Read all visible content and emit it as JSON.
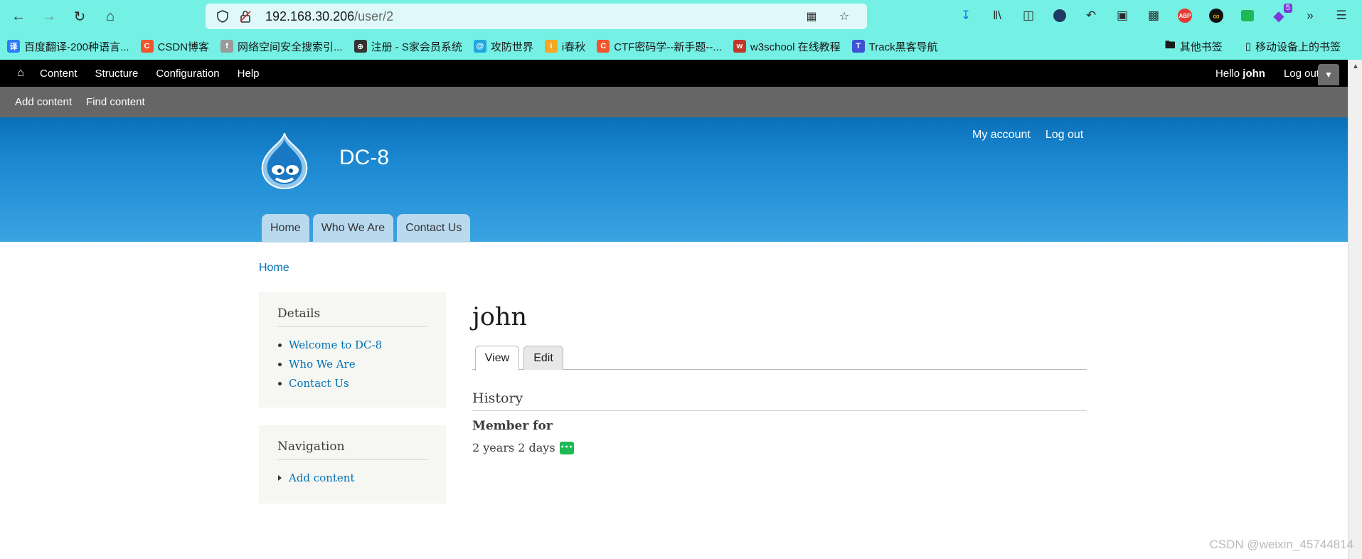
{
  "browser": {
    "url_host": "192.168.30.206",
    "url_path": "/user/2",
    "extension_badge": "5",
    "bookmarks": [
      {
        "label": "百度翻译-200种语言...",
        "icon_text": "译",
        "color": "#2c7cf6"
      },
      {
        "label": "CSDN博客",
        "icon_text": "C",
        "color": "#f2542d"
      },
      {
        "label": "网络空间安全搜索引...",
        "icon_text": "f",
        "color": "#9a9a9a"
      },
      {
        "label": "注册 - S家会员系统",
        "icon_text": "⊕",
        "color": "#333333"
      },
      {
        "label": "攻防世界",
        "icon_text": "@",
        "color": "#21a7e0"
      },
      {
        "label": "i春秋",
        "icon_text": "i",
        "color": "#f5a623"
      },
      {
        "label": "CTF密码学--新手题--...",
        "icon_text": "C",
        "color": "#f2542d"
      },
      {
        "label": "w3school 在线教程",
        "icon_text": "w",
        "color": "#c0392b"
      },
      {
        "label": "Track黑客导航",
        "icon_text": "T",
        "color": "#3d52d5"
      }
    ],
    "other_bookmarks": "其他书签",
    "mobile_bookmarks": "移动设备上的书签"
  },
  "admin_toolbar": {
    "links": [
      "Content",
      "Structure",
      "Configuration",
      "Help"
    ],
    "hello_prefix": "Hello ",
    "username": "john",
    "logout": "Log out"
  },
  "shortcuts": [
    "Add content",
    "Find content"
  ],
  "header": {
    "site_name": "DC-8",
    "secondary_menu": [
      "My account",
      "Log out"
    ],
    "primary_tabs": [
      "Home",
      "Who We Are",
      "Contact Us"
    ]
  },
  "breadcrumb": "Home",
  "sidebar": {
    "details": {
      "title": "Details",
      "items": [
        "Welcome to DC-8",
        "Who We Are",
        "Contact Us"
      ]
    },
    "navigation": {
      "title": "Navigation",
      "items": [
        "Add content"
      ]
    }
  },
  "main": {
    "title": "john",
    "tabs": [
      "View",
      "Edit"
    ],
    "section_title": "History",
    "field_label": "Member for",
    "field_value": "2 years 2 days"
  },
  "watermark": "CSDN @weixin_45744814"
}
